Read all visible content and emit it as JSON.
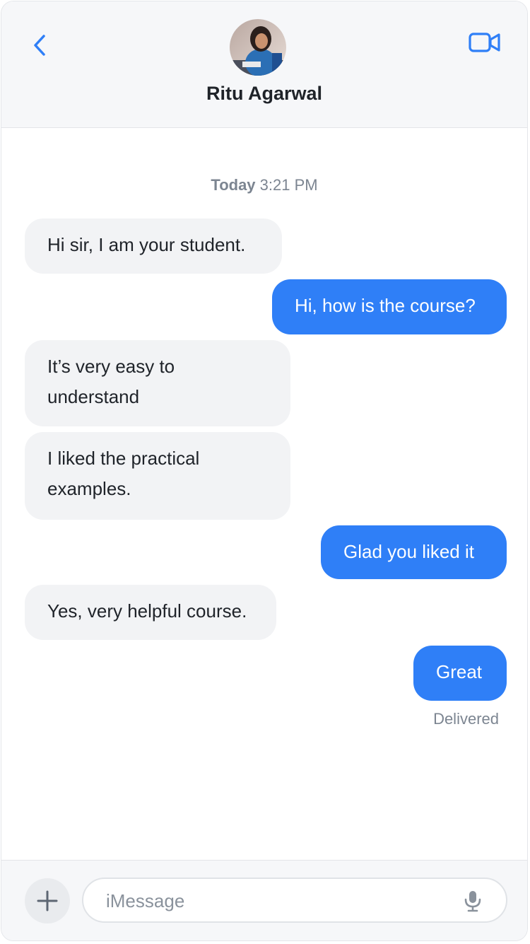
{
  "header": {
    "contact_name": "Ritu Agarwal",
    "back_icon": "chevron-left-icon",
    "video_icon": "video-camera-icon",
    "accent_color": "#2f7ff7"
  },
  "conversation": {
    "timestamp_day": "Today",
    "timestamp_time": "3:21 PM",
    "messages": [
      {
        "direction": "incoming",
        "text": "Hi sir, I am your student."
      },
      {
        "direction": "outgoing",
        "text": "Hi, how is the course?"
      },
      {
        "direction": "incoming",
        "text": "It’s very easy to understand"
      },
      {
        "direction": "incoming",
        "text": "I liked the practical examples."
      },
      {
        "direction": "outgoing",
        "text": "Glad you liked it"
      },
      {
        "direction": "incoming",
        "text": "Yes, very helpful course."
      },
      {
        "direction": "outgoing",
        "text": "Great"
      }
    ],
    "status": "Delivered",
    "incoming_bubble_color": "#f2f3f5",
    "outgoing_bubble_color": "#2f7ff7"
  },
  "composer": {
    "placeholder": "iMessage",
    "value": "",
    "plus_icon": "plus-icon",
    "mic_icon": "microphone-icon"
  }
}
